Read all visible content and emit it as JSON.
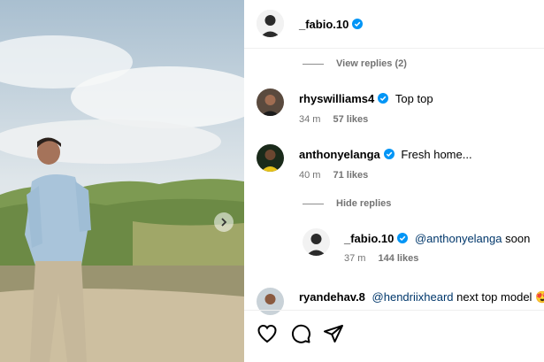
{
  "post_author": {
    "username": "_fabio.10",
    "verified_icon": "verified-badge-icon"
  },
  "comments": [
    {
      "username": "rhyswilliams4",
      "text": "Top top",
      "time": "34 m",
      "likes": "57 likes"
    },
    {
      "username": "anthonyelanga",
      "text": "Fresh home...",
      "time": "40 m",
      "likes": "71 likes"
    },
    {
      "username": "ryandehav.8",
      "mention": "@hendriixheard",
      "text": "next top model",
      "emoji": "😍"
    }
  ],
  "view_replies": "View replies (2)",
  "hide_replies": "Hide replies",
  "reply": {
    "username": "_fabio.10",
    "mention": "@anthonyelanga",
    "text": "soon",
    "time": "37 m",
    "likes": "144 likes"
  },
  "actions": {
    "like_icon": "heart-icon",
    "comment_icon": "comment-icon",
    "share_icon": "share-icon"
  },
  "colors": {
    "verified": "#0095f6",
    "mention": "#00376b",
    "meta": "#737373"
  }
}
